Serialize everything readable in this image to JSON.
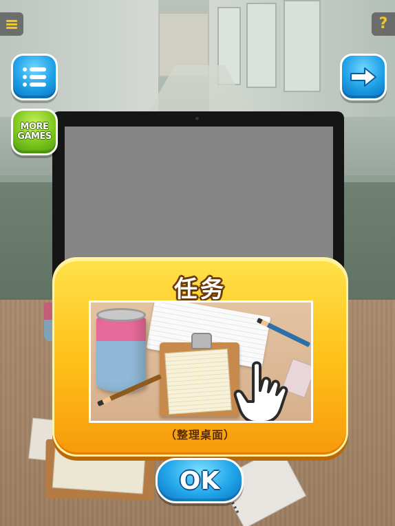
{
  "hud": {
    "menu_icon": "hamburger-icon",
    "help_icon": "question-icon",
    "help_label": "?",
    "list_icon": "list-icon",
    "next_icon": "arrow-right-icon",
    "more_games_line1": "MORE",
    "more_games_line2": "GAMES"
  },
  "dialog": {
    "title": "任务",
    "caption": "（整理桌面）",
    "ok_label": "OK"
  },
  "colors": {
    "dialog_yellow": "#ffc21a",
    "button_blue": "#1d9fe6",
    "button_green": "#7cc61d",
    "hud_accent": "#f2c623"
  }
}
